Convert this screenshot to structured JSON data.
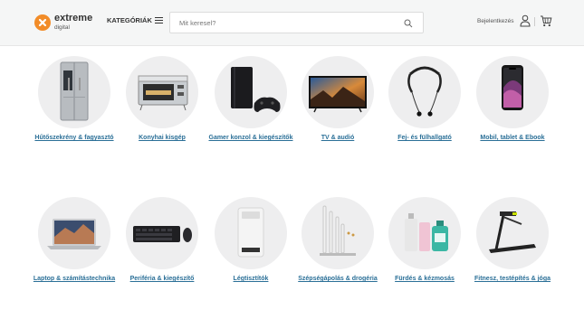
{
  "brand": {
    "name": "extreme",
    "sub": "digital",
    "color": "#f28c28"
  },
  "nav": {
    "categories_label": "KATEGÓRIÁK"
  },
  "search": {
    "placeholder": "Mit keresel?"
  },
  "account": {
    "login_label": "Bejelentkezés"
  },
  "categories": [
    {
      "label": "Hűtőszekrény & fagyasztó",
      "icon": "fridge-icon"
    },
    {
      "label": "Konyhai kisgép",
      "icon": "toaster-oven-icon"
    },
    {
      "label": "Gamer konzol & kiegészítők",
      "icon": "game-console-icon"
    },
    {
      "label": "TV & audió",
      "icon": "tv-icon"
    },
    {
      "label": "Fej- és fülhallgató",
      "icon": "earphones-icon"
    },
    {
      "label": "Mobil, tablet & Ebook",
      "icon": "smartphone-icon"
    },
    {
      "label": "Laptop & számítástechnika",
      "icon": "laptop-icon"
    },
    {
      "label": "Periféria & kiegészítő",
      "icon": "keyboard-mouse-icon"
    },
    {
      "label": "Légtisztítók",
      "icon": "air-purifier-icon"
    },
    {
      "label": "Szépségápolás & drogéria",
      "icon": "toothbrush-icon"
    },
    {
      "label": "Fürdés & kézmosás",
      "icon": "soap-bottles-icon"
    },
    {
      "label": "Fitnesz, testépítés & jóga",
      "icon": "treadmill-icon"
    }
  ]
}
